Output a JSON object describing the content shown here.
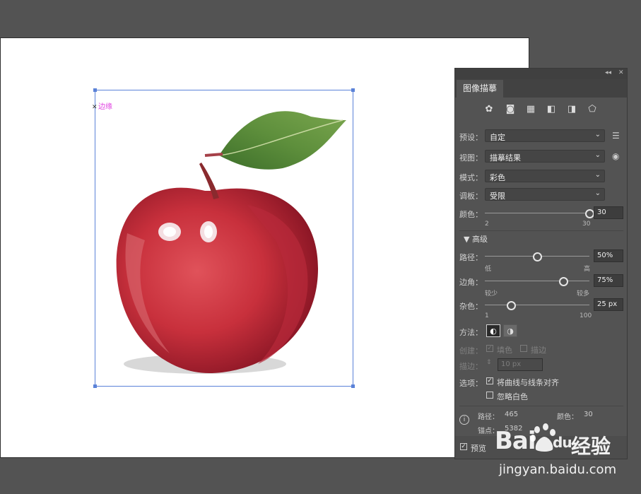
{
  "canvas": {
    "edge_label": "边缘"
  },
  "panel": {
    "title": "图像描摹",
    "topbar_collapse": "◂◂",
    "topbar_close": "✕",
    "icons": [
      "auto-color-icon",
      "high-color-icon",
      "low-color-icon",
      "grayscale-icon",
      "black-white-icon",
      "outline-icon"
    ],
    "preset": {
      "label": "预设：",
      "value": "自定"
    },
    "view": {
      "label": "视图：",
      "value": "描摹结果"
    },
    "mode": {
      "label": "模式：",
      "value": "彩色"
    },
    "palette": {
      "label": "调板：",
      "value": "受限"
    },
    "colors": {
      "label": "颜色：",
      "value": "30",
      "min": "2",
      "max": "30",
      "level": 1.0
    },
    "advanced_label": "高级",
    "paths": {
      "label": "路径：",
      "value": "50%",
      "low": "低",
      "high": "高",
      "level": 0.5
    },
    "corners": {
      "label": "边角：",
      "value": "75%",
      "low": "较少",
      "high": "较多",
      "level": 0.75
    },
    "noise": {
      "label": "杂色：",
      "value": "25 px",
      "min": "1",
      "max": "100",
      "level": 0.25
    },
    "method": {
      "label": "方法："
    },
    "create": {
      "label": "创建：",
      "fill": "填色",
      "stroke": "描边"
    },
    "stroke": {
      "label": "描边：",
      "value": "10 px"
    },
    "options": {
      "label": "选项：",
      "snap": "将曲线与线条对齐",
      "ignore_white": "忽略白色"
    },
    "stats": {
      "paths_label": "路径：",
      "paths_value": "465",
      "colors_label": "颜色：",
      "colors_value": "30",
      "anchors_label": "锚点：",
      "anchors_value": "5382"
    },
    "preview": "预览"
  },
  "watermark": {
    "logo": "Bai",
    "logo_suffix": "du",
    "jingyan": "经验",
    "url": "jingyan.baidu.com"
  }
}
